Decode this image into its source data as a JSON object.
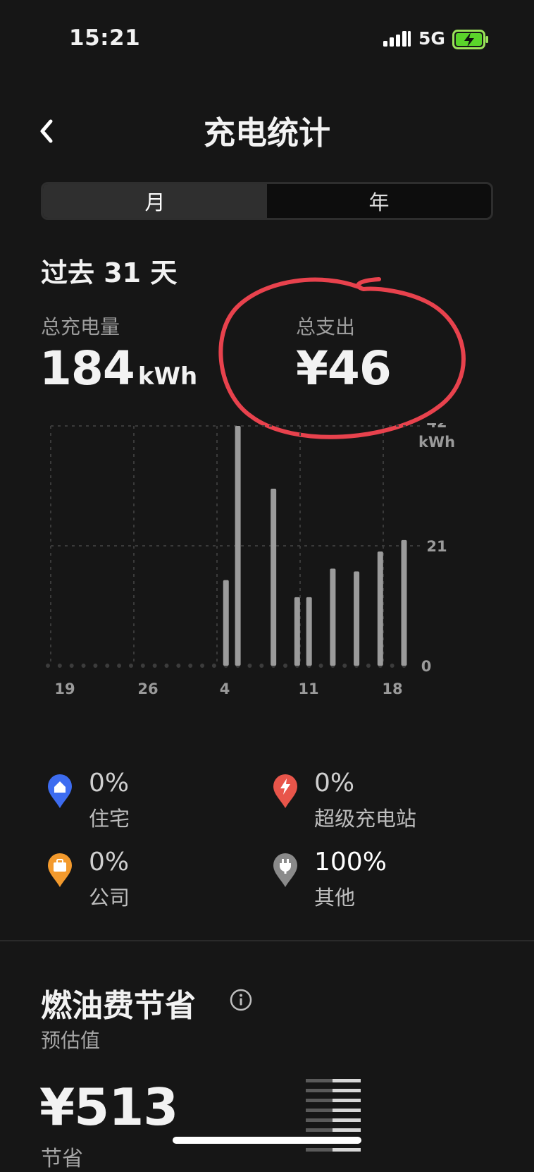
{
  "status": {
    "time": "15:21",
    "network": "5G"
  },
  "header": {
    "title": "充电统计",
    "back_icon": "chevron-left-icon"
  },
  "tabs": [
    {
      "label": "月",
      "active": true
    },
    {
      "label": "年",
      "active": false
    }
  ],
  "period": "过去 31 天",
  "total_energy": {
    "label": "总充电量",
    "value": "184",
    "unit": "kWh"
  },
  "total_cost": {
    "label": "总支出",
    "value": "¥46",
    "highlight_color": "#e8424d"
  },
  "chart_data": {
    "type": "bar",
    "ylabel": "kWh",
    "y_ticks": [
      "0",
      "21",
      "42"
    ],
    "ylim": [
      0,
      42
    ],
    "x_tick_labels": [
      "19",
      "26",
      "4",
      "11",
      "18"
    ],
    "bars": [
      {
        "day": "3",
        "value": 15
      },
      {
        "day": "4",
        "value": 42
      },
      {
        "day": "7",
        "value": 31
      },
      {
        "day": "9",
        "value": 12
      },
      {
        "day": "10",
        "value": 12
      },
      {
        "day": "12",
        "value": 17
      },
      {
        "day": "14",
        "value": 16.5
      },
      {
        "day": "16",
        "value": 20
      },
      {
        "day": "18",
        "value": 22
      }
    ]
  },
  "legend": [
    {
      "icon": "home-pin-icon",
      "color": "#3d6cf0",
      "percent": "0%",
      "name": "住宅"
    },
    {
      "icon": "lightning-pin-icon",
      "color": "#e8554a",
      "percent": "0%",
      "name": "超级充电站"
    },
    {
      "icon": "briefcase-pin-icon",
      "color": "#f39a2d",
      "percent": "0%",
      "name": "公司"
    },
    {
      "icon": "plug-pin-icon",
      "color": "#8a8a8a",
      "percent": "100%",
      "name": "其他"
    }
  ],
  "savings": {
    "title": "燃油费节省",
    "info_icon": "info-icon",
    "subtitle": "预估值",
    "amount": "¥513",
    "label": "节省"
  }
}
